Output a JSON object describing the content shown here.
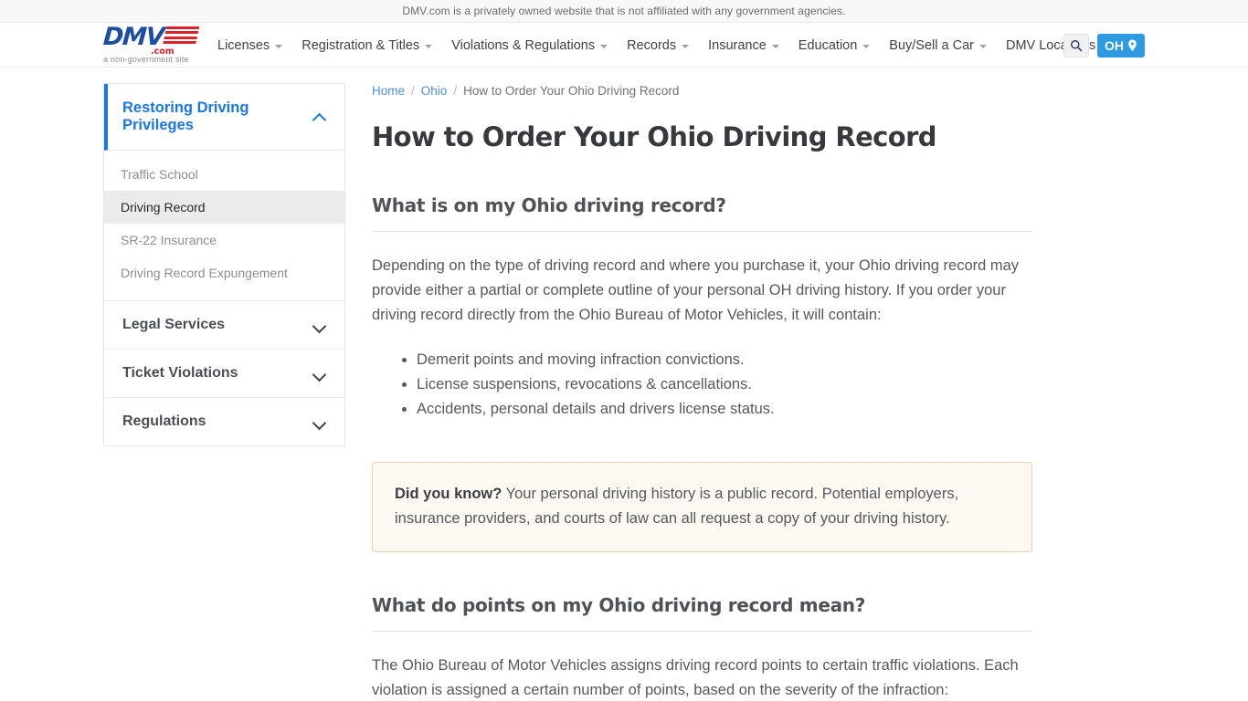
{
  "disclaimer": {
    "text": "DMV.com is a privately owned website that is not affiliated with any government agencies."
  },
  "header": {
    "logo": {
      "name": "DMV",
      "dotcom": ".com",
      "tagline": "a non-government site"
    },
    "nav": [
      {
        "label": "Licenses",
        "has_dropdown": true
      },
      {
        "label": "Registration & Titles",
        "has_dropdown": true
      },
      {
        "label": "Violations & Regulations",
        "has_dropdown": true
      },
      {
        "label": "Records",
        "has_dropdown": true
      },
      {
        "label": "Insurance",
        "has_dropdown": true
      },
      {
        "label": "Education",
        "has_dropdown": true
      },
      {
        "label": "Buy/Sell a Car",
        "has_dropdown": true
      },
      {
        "label": "DMV Locations",
        "has_dropdown": false
      }
    ],
    "search_icon": "search-icon",
    "state_button": {
      "label": "OH",
      "icon": "location-pin-icon",
      "color": "#2e9ae2"
    }
  },
  "sidebar": {
    "sections": [
      {
        "label": "Restoring Driving Privileges",
        "expanded": true,
        "accent_color": "#1877e0",
        "items": [
          {
            "label": "Traffic School",
            "active": false
          },
          {
            "label": "Driving Record",
            "active": true
          },
          {
            "label": "SR-22 Insurance",
            "active": false
          },
          {
            "label": "Driving Record Expungement",
            "active": false
          }
        ]
      },
      {
        "label": "Legal Services",
        "expanded": false,
        "items": []
      },
      {
        "label": "Ticket Violations",
        "expanded": false,
        "items": []
      },
      {
        "label": "Regulations",
        "expanded": false,
        "items": []
      }
    ]
  },
  "breadcrumb": {
    "home": "Home",
    "state": "Ohio",
    "current": "How to Order Your Ohio Driving Record",
    "separator": "/"
  },
  "main": {
    "title": "How to Order Your Ohio Driving Record",
    "section1": {
      "heading": "What is on my Ohio driving record?",
      "paragraph": "Depending on the type of driving record and where you purchase it, your Ohio driving record may provide either a partial or complete outline of your personal OH driving history. If you order your driving record directly from the Ohio Bureau of Motor Vehicles, it will contain:",
      "bullets": [
        "Demerit points and moving infraction convictions.",
        "License suspensions, revocations & cancellations.",
        "Accidents, personal details and drivers license status."
      ]
    },
    "callout": {
      "lead": "Did you know?",
      "text": " Your personal driving history is a public record. Potential employers, insurance providers, and courts of law can all request a copy of your driving history."
    },
    "section2": {
      "heading": "What do points on my Ohio driving record mean?",
      "paragraph": "The Ohio Bureau of Motor Vehicles assigns driving record points to certain traffic violations. Each violation is assigned a certain number of points, based on the severity of the infraction:"
    }
  }
}
